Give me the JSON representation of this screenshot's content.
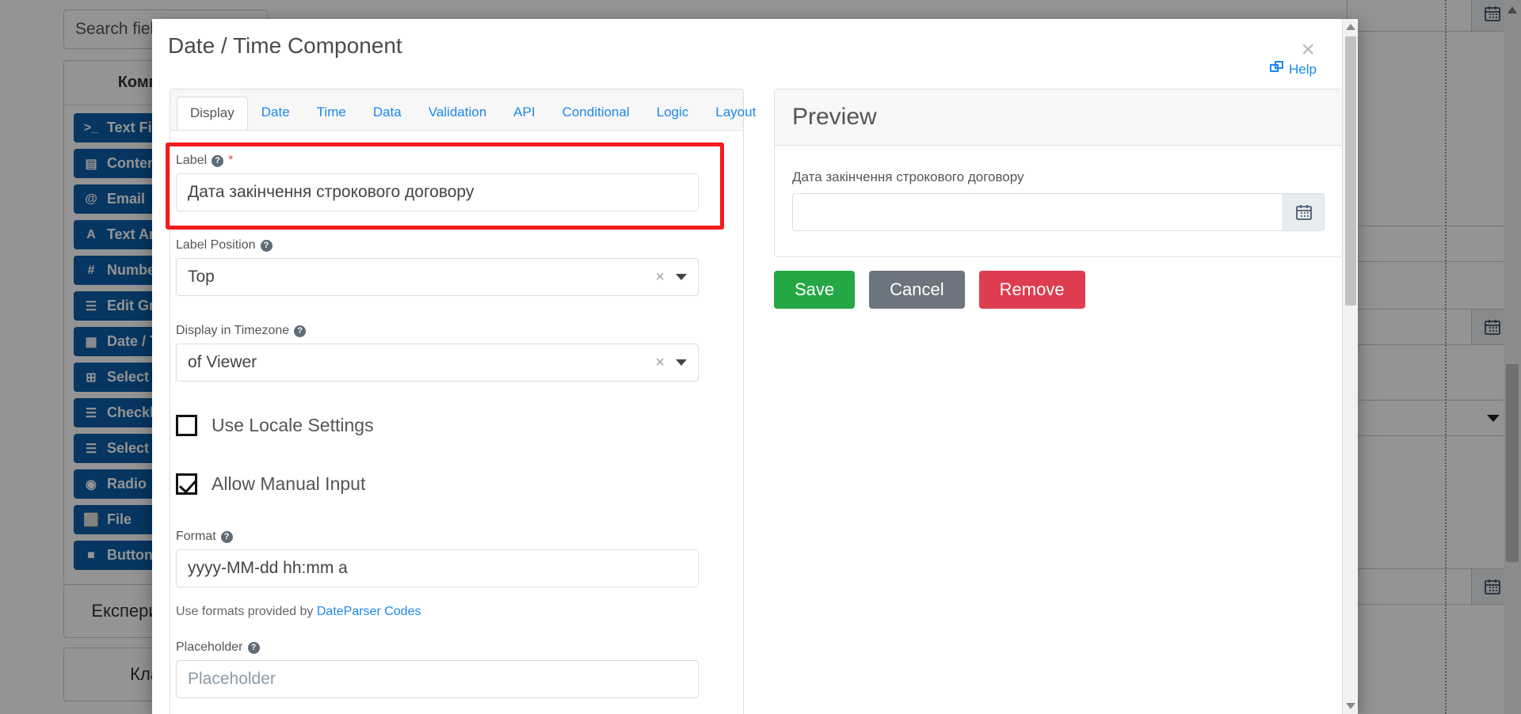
{
  "background": {
    "search_placeholder": "Search fields",
    "panel_title": "Компоненти",
    "components": [
      {
        "icon": ">_",
        "label": "Text Field"
      },
      {
        "icon": "▤",
        "label": "Content"
      },
      {
        "icon": "@",
        "label": "Email"
      },
      {
        "icon": "A",
        "label": "Text Area"
      },
      {
        "icon": "#",
        "label": "Number"
      },
      {
        "icon": "☰",
        "label": "Edit Grid"
      },
      {
        "icon": "▦",
        "label": "Date / Time"
      },
      {
        "icon": "⊞",
        "label": "Select Boxes"
      },
      {
        "icon": "☰",
        "label": "Checkbox"
      },
      {
        "icon": "☰",
        "label": "Select"
      },
      {
        "icon": "◉",
        "label": "Radio"
      },
      {
        "icon": "⬜",
        "label": "File"
      },
      {
        "icon": "■",
        "label": "Button"
      }
    ],
    "block_labels": [
      "Експериментальні",
      "Класичні"
    ]
  },
  "modal": {
    "title": "Date / Time Component",
    "close_label": "×",
    "help_label": "Help",
    "tabs": [
      {
        "label": "Display",
        "active": true
      },
      {
        "label": "Date",
        "active": false
      },
      {
        "label": "Time",
        "active": false
      },
      {
        "label": "Data",
        "active": false
      },
      {
        "label": "Validation",
        "active": false
      },
      {
        "label": "API",
        "active": false
      },
      {
        "label": "Conditional",
        "active": false
      },
      {
        "label": "Logic",
        "active": false
      },
      {
        "label": "Layout",
        "active": false
      }
    ],
    "fields": {
      "label": {
        "label": "Label",
        "required_marker": "*",
        "value": "Дата закінчення строкового договору",
        "highlighted": true
      },
      "label_position": {
        "label": "Label Position",
        "value": "Top",
        "clear_icon": "×"
      },
      "display_in_timezone": {
        "label": "Display in Timezone",
        "value": "of Viewer",
        "clear_icon": "×"
      },
      "use_locale_settings": {
        "label": "Use Locale Settings",
        "checked": false
      },
      "allow_manual_input": {
        "label": "Allow Manual Input",
        "checked": true
      },
      "format": {
        "label": "Format",
        "value": "yyyy-MM-dd hh:mm a",
        "help_prefix": "Use formats provided by ",
        "help_link": "DateParser Codes"
      },
      "placeholder": {
        "label": "Placeholder",
        "value": "",
        "placeholder": "Placeholder"
      }
    },
    "preview": {
      "title": "Preview",
      "field_label": "Дата закінчення строкового договору",
      "field_value": ""
    },
    "buttons": {
      "save": {
        "label": "Save",
        "color": "#26a745"
      },
      "cancel": {
        "label": "Cancel",
        "color": "#6c757d"
      },
      "remove": {
        "label": "Remove",
        "color": "#dd3d4f"
      }
    }
  },
  "colors": {
    "highlight_border": "#f41c1c",
    "link": "#1e87f0",
    "component_button": "#0b5ea8"
  }
}
